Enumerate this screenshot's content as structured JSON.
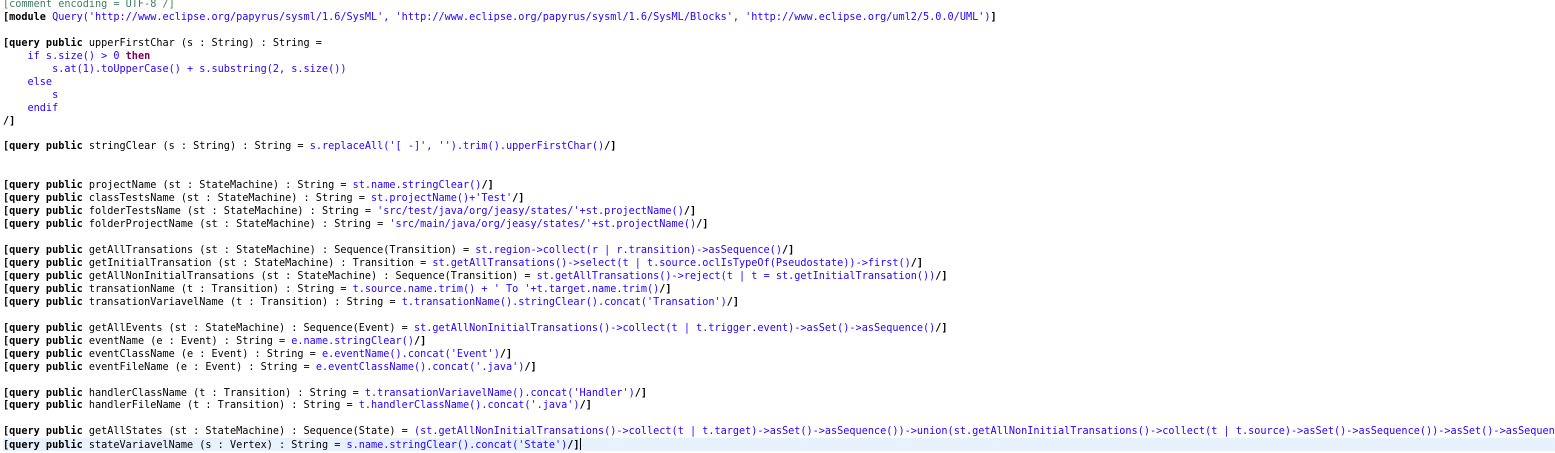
{
  "lines": [
    [
      [
        "comment",
        "[comment encoding = UTF-8 /]"
      ]
    ],
    [
      [
        "bracket",
        "[module "
      ],
      [
        "expr",
        "Query('http://www.eclipse.org/papyrus/sysml/1.6/SysML', 'http://www.eclipse.org/papyrus/sysml/1.6/SysML/Blocks', 'http://www.eclipse.org/uml2/5.0.0/UML')"
      ],
      [
        "bracket",
        "]"
      ]
    ],
    [],
    [
      [
        "bracket",
        "[query public "
      ],
      [
        "plain",
        "upperFirstChar (s : String) : String ="
      ]
    ],
    [
      [
        "expr",
        "    if s.size() > 0 "
      ],
      [
        "kw",
        "then"
      ]
    ],
    [
      [
        "expr",
        "        s.at(1).toUpperCase() + s.substring(2, s.size())"
      ]
    ],
    [
      [
        "expr",
        "    else"
      ]
    ],
    [
      [
        "expr",
        "        s"
      ]
    ],
    [
      [
        "expr",
        "    endif"
      ]
    ],
    [
      [
        "bracket",
        "/]"
      ]
    ],
    [],
    [
      [
        "bracket",
        "[query public "
      ],
      [
        "plain",
        "stringClear (s : String) : String = "
      ],
      [
        "expr",
        "s.replaceAll('[ -]', '').trim().upperFirstChar()"
      ],
      [
        "bracket",
        "/]"
      ]
    ],
    [],
    [],
    [
      [
        "bracket",
        "[query public "
      ],
      [
        "plain",
        "projectName (st : StateMachine) : String = "
      ],
      [
        "expr",
        "st.name.stringClear()"
      ],
      [
        "bracket",
        "/]"
      ]
    ],
    [
      [
        "bracket",
        "[query public "
      ],
      [
        "plain",
        "classTestsName (st : StateMachine) : String = "
      ],
      [
        "expr",
        "st.projectName()+'Test'"
      ],
      [
        "bracket",
        "/]"
      ]
    ],
    [
      [
        "bracket",
        "[query public "
      ],
      [
        "plain",
        "folderTestsName (st : StateMachine) : String = "
      ],
      [
        "expr",
        "'src/test/java/org/jeasy/states/'+st.projectName()"
      ],
      [
        "bracket",
        "/]"
      ]
    ],
    [
      [
        "bracket",
        "[query public "
      ],
      [
        "plain",
        "folderProjectName (st : StateMachine) : String = "
      ],
      [
        "expr",
        "'src/main/java/org/jeasy/states/'+st.projectName()"
      ],
      [
        "bracket",
        "/]"
      ]
    ],
    [],
    [
      [
        "bracket",
        "[query public "
      ],
      [
        "plain",
        "getAllTransations (st : StateMachine) : Sequence(Transition) = "
      ],
      [
        "expr",
        "st.region->collect(r | r.transition)->asSequence()"
      ],
      [
        "bracket",
        "/]"
      ]
    ],
    [
      [
        "bracket",
        "[query public "
      ],
      [
        "plain",
        "getInitialTransation (st : StateMachine) : Transition = "
      ],
      [
        "expr",
        "st.getAllTransations()->select(t | t.source.oclIsTypeOf(Pseudostate))->first()"
      ],
      [
        "bracket",
        "/]"
      ]
    ],
    [
      [
        "bracket",
        "[query public "
      ],
      [
        "plain",
        "getAllNonInitialTransations (st : StateMachine) : Sequence(Transition) = "
      ],
      [
        "expr",
        "st.getAllTransations()->reject(t | t = st.getInitialTransation())"
      ],
      [
        "bracket",
        "/]"
      ]
    ],
    [
      [
        "bracket",
        "[query public "
      ],
      [
        "plain",
        "transationName (t : Transition) : String = "
      ],
      [
        "expr",
        "t.source.name.trim() + ' To '+t.target.name.trim()"
      ],
      [
        "bracket",
        "/]"
      ]
    ],
    [
      [
        "bracket",
        "[query public "
      ],
      [
        "plain",
        "transationVariavelName (t : Transition) : String = "
      ],
      [
        "expr",
        "t.transationName().stringClear().concat('Transation')"
      ],
      [
        "bracket",
        "/]"
      ]
    ],
    [],
    [
      [
        "bracket",
        "[query public "
      ],
      [
        "plain",
        "getAllEvents (st : StateMachine) : Sequence(Event) = "
      ],
      [
        "expr",
        "st.getAllNonInitialTransations()->collect(t | t.trigger.event)->asSet()->asSequence()"
      ],
      [
        "bracket",
        "/]"
      ]
    ],
    [
      [
        "bracket",
        "[query public "
      ],
      [
        "plain",
        "eventName (e : Event) : String = "
      ],
      [
        "expr",
        "e.name.stringClear()"
      ],
      [
        "bracket",
        "/]"
      ]
    ],
    [
      [
        "bracket",
        "[query public "
      ],
      [
        "plain",
        "eventClassName (e : Event) : String = "
      ],
      [
        "expr",
        "e.eventName().concat('Event')"
      ],
      [
        "bracket",
        "/]"
      ]
    ],
    [
      [
        "bracket",
        "[query public "
      ],
      [
        "plain",
        "eventFileName (e : Event) : String = "
      ],
      [
        "expr",
        "e.eventClassName().concat('.java')"
      ],
      [
        "bracket",
        "/]"
      ]
    ],
    [],
    [
      [
        "bracket",
        "[query public "
      ],
      [
        "plain",
        "handlerClassName (t : Transition) : String = "
      ],
      [
        "expr",
        "t.transationVariavelName().concat('Handler')"
      ],
      [
        "bracket",
        "/]"
      ]
    ],
    [
      [
        "bracket",
        "[query public "
      ],
      [
        "plain",
        "handlerFileName (t : Transition) : String = "
      ],
      [
        "expr",
        "t.handlerClassName().concat('.java')"
      ],
      [
        "bracket",
        "/]"
      ]
    ],
    [],
    [
      [
        "bracket",
        "[query public "
      ],
      [
        "plain",
        "getAllStates (st : StateMachine) : Sequence(State) = "
      ],
      [
        "expr",
        "(st.getAllNonInitialTransations()->collect(t | t.target)->asSet()->asSequence())->union(st.getAllNonInitialTransations()->collect(t | t.source)->asSet()->asSequence())->asSet()->asSequence()"
      ],
      [
        "bracket",
        "/]"
      ]
    ],
    [
      [
        "bracket",
        "[query public "
      ],
      [
        "plain",
        "stateVariavelName (s : Vertex) : String = "
      ],
      [
        "expr",
        "s.name.stringClear().concat('State')"
      ],
      [
        "bracket",
        "/]"
      ]
    ]
  ],
  "current_line": 34,
  "colors": {
    "comment": "#3f7f5f",
    "keyword": "#7f0055",
    "expression": "#2a00ff",
    "current_line_bg": "#e8f2fe"
  }
}
